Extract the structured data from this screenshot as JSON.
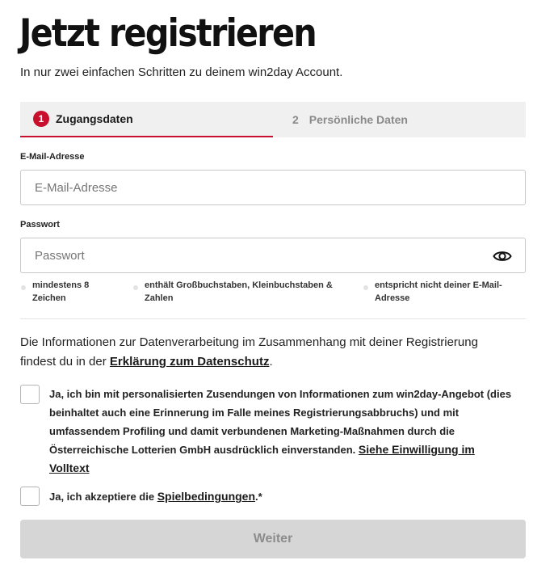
{
  "header": {
    "title": "Jetzt registrieren",
    "subtitle": "In nur zwei einfachen Schritten zu deinem win2day Account."
  },
  "steps": [
    {
      "number": "1",
      "label": "Zugangsdaten",
      "active": true
    },
    {
      "number": "2",
      "label": "Persönliche Daten",
      "active": false
    }
  ],
  "email": {
    "label": "E-Mail-Adresse",
    "placeholder": "E-Mail-Adresse",
    "value": ""
  },
  "password": {
    "label": "Passwort",
    "placeholder": "Passwort",
    "value": "",
    "toggle_icon": "eye-icon",
    "rules": [
      {
        "line1": "mindestens 8",
        "line2": "Zeichen"
      },
      {
        "line1": "enthält Großbuchstaben, Kleinbuchstaben &",
        "line2": "Zahlen"
      },
      {
        "line1": "entspricht nicht deiner E-Mail-",
        "line2": "Adresse"
      }
    ]
  },
  "privacy": {
    "text_line1": "Die Informationen zur Datenverarbeitung im Zusammenhang mit deiner Registrierung",
    "text_line2_before": "findest du in der ",
    "link": "Erklärung zum Datenschutz",
    "text_line2_after": "."
  },
  "marketing_consent": {
    "line1": "Ja, ich bin mit personalisierten Zusendungen von Informationen zum win2day-Angebot (dies",
    "line2": "beinhaltet auch eine Erinnerung im Falle meines Registrierungsabbruchs) und mit",
    "line3": "umfassendem Profiling und damit verbundenen Marketing-Maßnahmen durch die",
    "line4": "Österreichische Lotterien GmbH ausdrücklich einverstanden. ",
    "link_part1": "Siehe Einwilligung im",
    "link_part2": "Volltext",
    "checked": false
  },
  "terms_consent": {
    "text_before": "Ja, ich akzeptiere die ",
    "link": "Spielbedingungen",
    "text_after": ".*",
    "checked": false
  },
  "submit": {
    "label": "Weiter",
    "enabled": false
  },
  "colors": {
    "accent": "#c8102e",
    "button_disabled_bg": "#d6d6d6",
    "button_disabled_text": "#8c8c8c",
    "step_bar_bg": "#f0f0f0"
  }
}
